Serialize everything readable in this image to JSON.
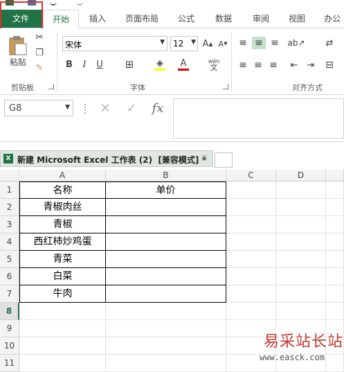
{
  "ribbon_tabs": [
    "文件",
    "开始",
    "插入",
    "页面布局",
    "公式",
    "数据",
    "审阅",
    "视图",
    "办公"
  ],
  "clipboard": {
    "paste_label": "粘贴",
    "group_label": "剪贴板"
  },
  "font": {
    "name": "宋体",
    "size": "12",
    "bold": "B",
    "italic": "I",
    "underline": "U",
    "group_label": "字体",
    "wen": "wén"
  },
  "alignment": {
    "group_label": "对齐方式"
  },
  "formula_bar": {
    "name_box": "G8",
    "cancel": "✕",
    "confirm": "✓",
    "fx": "fx",
    "formula": ""
  },
  "sheet_tab": {
    "label": "新建 Microsoft Excel 工作表 (2)  [兼容模式] *",
    "close": "✕"
  },
  "columns": [
    "A",
    "B",
    "C",
    "D"
  ],
  "rows": [
    "1",
    "2",
    "3",
    "4",
    "5",
    "6",
    "7",
    "8",
    "9",
    "10",
    "11"
  ],
  "table": {
    "header": [
      "名称",
      "单价"
    ],
    "items": [
      "青椒肉丝",
      "青椒",
      "西红柿炒鸡蛋",
      "青菜",
      "白菜",
      "牛肉"
    ]
  },
  "watermark": {
    "text": "易采站长站",
    "url": "www.easck.com"
  },
  "colors": {
    "file_tab": "#217346",
    "highlight_box": "#d8302a",
    "selected_row": "#217346"
  }
}
